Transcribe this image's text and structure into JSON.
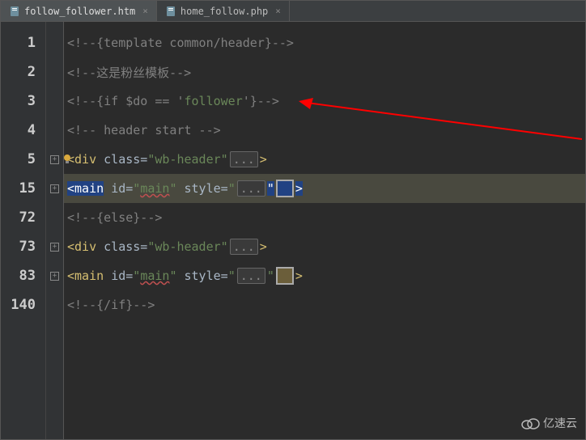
{
  "tabs": [
    {
      "label": "follow_follower.htm",
      "active": true
    },
    {
      "label": "home_follow.php",
      "active": false
    }
  ],
  "gutter": [
    "1",
    "2",
    "3",
    "4",
    "5",
    "15",
    "72",
    "73",
    "83",
    "140"
  ],
  "code": {
    "l1": "<!--{template common/header}-->",
    "l2": "<!--这是粉丝模板-->",
    "l3_a": "<!--{if $do == '",
    "l3_b": "follower",
    "l3_c": "'}-->",
    "l4": "<!-- header start -->",
    "l5_open": "<",
    "l5_tag": "div",
    "l5_sp": " ",
    "l5_attr": "class=",
    "l5_q": "\"",
    "l5_val": "wb-header",
    "l5_fold": "...",
    "l5_close": ">",
    "l6_open": "<",
    "l6_tag": "main",
    "l6_sp": " ",
    "l6_attr1": "id=",
    "l6_q": "\"",
    "l6_val1": "main",
    "l6_sp2": " ",
    "l6_attr2": "style=",
    "l6_fold": "...",
    "l6_close": ">",
    "l7": "<!--{else}-->",
    "l8_open": "<",
    "l8_tag": "div",
    "l8_attr": "class=",
    "l8_val": "wb-header",
    "l8_fold": "...",
    "l8_close": ">",
    "l9_open": "<",
    "l9_tag": "main",
    "l9_attr1": "id=",
    "l9_val1": "main",
    "l9_attr2": "style=",
    "l9_fold": "...",
    "l9_close": ">",
    "l10": "<!--{/if}-->"
  },
  "colors": {
    "swatch": "#6b5e3a"
  },
  "watermark": "亿速云"
}
